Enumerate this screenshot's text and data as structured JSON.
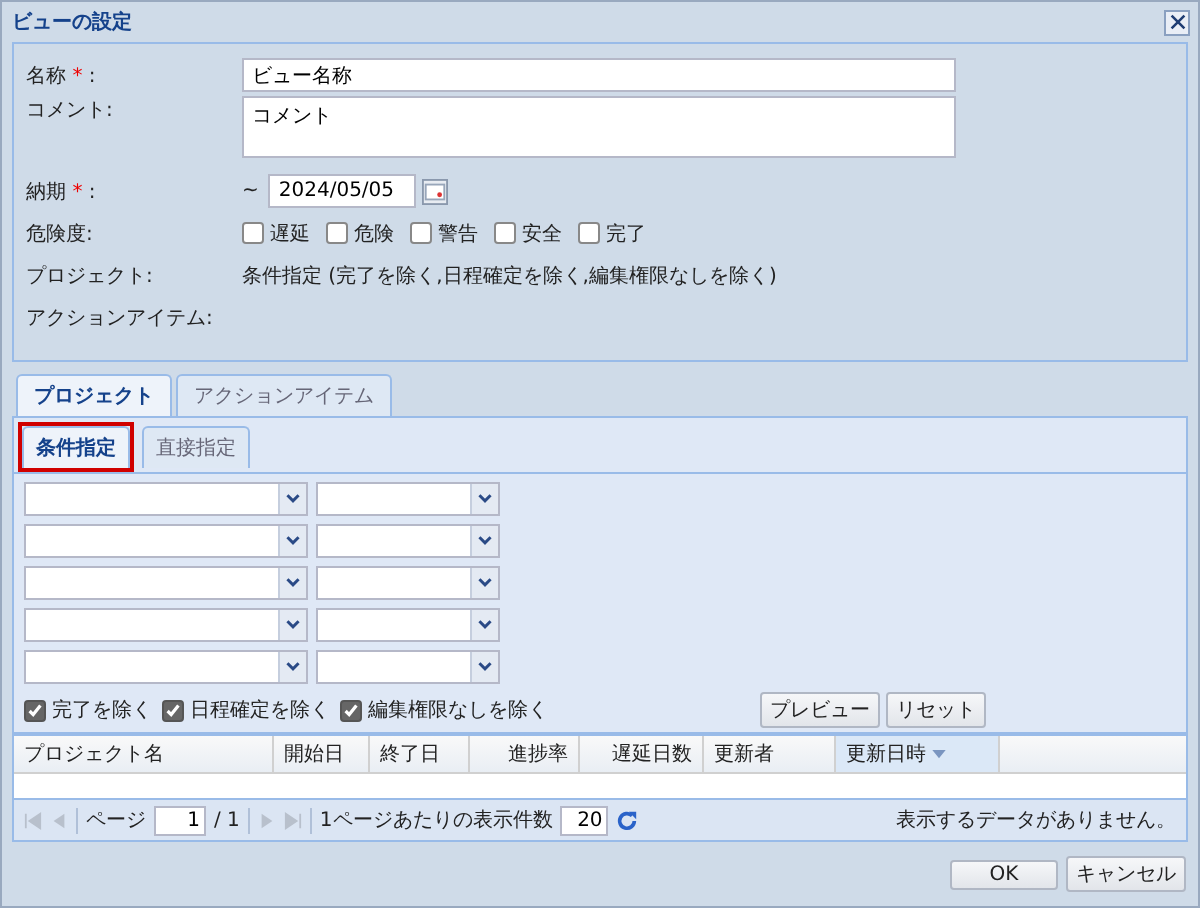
{
  "window": {
    "title": "ビューの設定"
  },
  "form": {
    "name": {
      "label": "名称",
      "required_mark": "*",
      "label_end": ":",
      "value": "ビュー名称"
    },
    "comment": {
      "label": "コメント:",
      "value": "コメント"
    },
    "deadline": {
      "label": "納期",
      "required_mark": "*",
      "label_end": ":",
      "prefix": "~",
      "value": "2024/05/05"
    },
    "risk": {
      "label": "危険度:",
      "options": [
        {
          "label": "遅延",
          "checked": false
        },
        {
          "label": "危険",
          "checked": false
        },
        {
          "label": "警告",
          "checked": false
        },
        {
          "label": "安全",
          "checked": false
        },
        {
          "label": "完了",
          "checked": false
        }
      ]
    },
    "project": {
      "label": "プロジェクト:",
      "value": "条件指定 (完了を除く,日程確定を除く,編集権限なしを除く)"
    },
    "action_item": {
      "label": "アクションアイテム:"
    }
  },
  "tabs": [
    {
      "label": "プロジェクト",
      "selected": true
    },
    {
      "label": "アクションアイテム",
      "selected": false
    }
  ],
  "subtabs": [
    {
      "label": "条件指定",
      "selected": true,
      "highlighted": true
    },
    {
      "label": "直接指定",
      "selected": false,
      "highlighted": false
    }
  ],
  "filter_rows": [
    {
      "kind": "combo_pair"
    },
    {
      "kind": "combo_pair"
    },
    {
      "kind": "combo_pair"
    },
    {
      "kind": "combo_pair"
    },
    {
      "kind": "combo_pair"
    }
  ],
  "exclusions": [
    {
      "label": "完了を除く",
      "checked": true
    },
    {
      "label": "日程確定を除く",
      "checked": true
    },
    {
      "label": "編集権限なしを除く",
      "checked": true
    }
  ],
  "filter_buttons": [
    "プレビュー",
    "リセット"
  ],
  "grid": {
    "columns": [
      {
        "label": "プロジェクト名",
        "kind": "text",
        "sorted": false
      },
      {
        "label": "開始日",
        "kind": "date",
        "sorted": false
      },
      {
        "label": "終了日",
        "kind": "date",
        "sorted": false
      },
      {
        "label": "進捗率",
        "kind": "number",
        "sorted": false
      },
      {
        "label": "遅延日数",
        "kind": "number",
        "sorted": false
      },
      {
        "label": "更新者",
        "kind": "text",
        "sorted": false
      },
      {
        "label": "更新日時",
        "kind": "date",
        "sorted": true
      }
    ]
  },
  "paging": {
    "page_label": "ページ",
    "page": "1",
    "page_total": "/ 1",
    "per_page_label": "1ページあたりの表示件数",
    "per_page": "20",
    "message": "表示するデータがありません。"
  },
  "buttons": [
    "OK",
    "キャンセル"
  ]
}
